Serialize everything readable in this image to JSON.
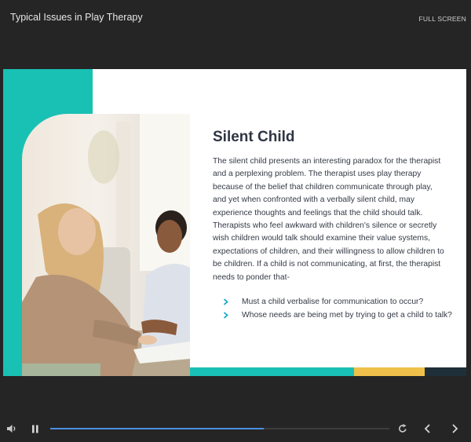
{
  "header": {
    "title": "Typical Issues in Play Therapy",
    "fullscreen_label": "FULL SCREEN"
  },
  "slide": {
    "heading": "Silent Child",
    "body": "The silent child presents an interesting paradox for the therapist and a perplexing problem. The therapist uses play therapy because of the belief that children communicate through play, and yet when confronted with a verbally silent child, may experience thoughts and feelings that the child should talk. Therapists who feel awkward with children's silence or secretly wish children would talk should examine their value systems, expectations of children, and their willingness to allow children to be children. If a child is not communicating, at first, the therapist needs to ponder that-",
    "bullets": [
      "Must a child verbalise for communication to occur?",
      "Whose needs are being met by trying to get a child to talk?"
    ],
    "colors": {
      "teal": "#19c0b4",
      "yellow": "#f0c14a",
      "navy": "#1f2f39"
    }
  },
  "player": {
    "progress_fraction": 0.63,
    "icons": [
      "volume-icon",
      "pause-icon",
      "replay-icon",
      "previous-icon",
      "next-icon"
    ],
    "accent": "#4a90e2"
  }
}
